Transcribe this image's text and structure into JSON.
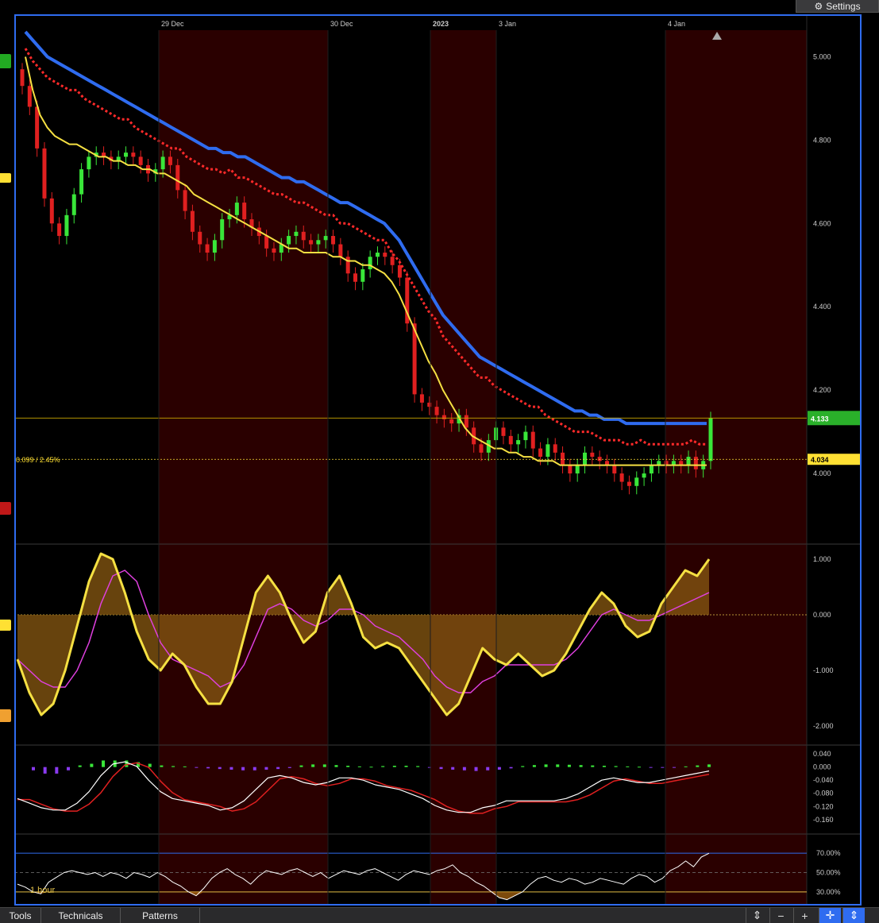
{
  "toolbar": {
    "settings_label": "Settings",
    "tabs": [
      "Tools",
      "Technicals",
      "Patterns"
    ],
    "buttons": [
      "⇕",
      "−",
      "+",
      "✛",
      "⇕"
    ]
  },
  "colors": {
    "up": "#39e639",
    "down": "#e02020",
    "ma_fast": "#f5e042",
    "ma_slow": "#2f6cf0",
    "stop": "#ff2a2a",
    "shade": "#2a0000",
    "price_tag": "#2ab02a",
    "ref_tag": "#ffe033"
  },
  "chart_data": [
    {
      "type": "candlestick",
      "x_labels": [
        "29 Dec",
        "30 Dec",
        "2023",
        "3 Jan",
        "4 Jan"
      ],
      "y_ticks": [
        "5.000",
        "4.800",
        "4.600",
        "4.400",
        "4.200",
        "4.000"
      ],
      "ylim": [
        3.84,
        5.06
      ],
      "last_price": "4.133",
      "last_price_value": 4.133,
      "reference_label": "0.099 / 2.45%",
      "reference_price": "4.034",
      "reference_value": 4.034,
      "close": [
        4.93,
        4.88,
        4.78,
        4.66,
        4.6,
        4.57,
        4.62,
        4.67,
        4.73,
        4.76,
        4.77,
        4.76,
        4.75,
        4.76,
        4.77,
        4.76,
        4.74,
        4.72,
        4.73,
        4.76,
        4.74,
        4.68,
        4.63,
        4.58,
        4.55,
        4.53,
        4.56,
        4.61,
        4.62,
        4.65,
        4.61,
        4.59,
        4.57,
        4.54,
        4.53,
        4.55,
        4.57,
        4.58,
        4.56,
        4.55,
        4.56,
        4.57,
        4.55,
        4.52,
        4.48,
        4.46,
        4.49,
        4.52,
        4.53,
        4.52,
        4.5,
        4.47,
        4.36,
        4.19,
        4.17,
        4.16,
        4.14,
        4.13,
        4.12,
        4.14,
        4.11,
        4.07,
        4.05,
        4.08,
        4.11,
        4.09,
        4.07,
        4.08,
        4.1,
        4.06,
        4.04,
        4.07,
        4.05,
        4.02,
        4.0,
        4.02,
        4.05,
        4.04,
        4.03,
        4.02,
        4.0,
        3.98,
        3.97,
        3.99,
        4.0,
        4.02,
        4.03,
        4.02,
        4.03,
        4.02,
        4.04,
        4.01,
        4.03,
        4.133
      ],
      "ma_fast": [
        5.0,
        4.92,
        4.86,
        4.83,
        4.81,
        4.8,
        4.79,
        4.79,
        4.78,
        4.77,
        4.76,
        4.76,
        4.75,
        4.75,
        4.74,
        4.74,
        4.73,
        4.73,
        4.72,
        4.72,
        4.71,
        4.7,
        4.69,
        4.67,
        4.66,
        4.65,
        4.64,
        4.63,
        4.62,
        4.61,
        4.6,
        4.59,
        4.58,
        4.57,
        4.56,
        4.55,
        4.54,
        4.54,
        4.53,
        4.53,
        4.53,
        4.53,
        4.52,
        4.52,
        4.51,
        4.51,
        4.5,
        4.5,
        4.49,
        4.48,
        4.46,
        4.43,
        4.39,
        4.35,
        4.31,
        4.27,
        4.24,
        4.2,
        4.17,
        4.14,
        4.11,
        4.09,
        4.08,
        4.07,
        4.06,
        4.06,
        4.05,
        4.05,
        4.04,
        4.04,
        4.03,
        4.03,
        4.03,
        4.02,
        4.02,
        4.02,
        4.02,
        4.02,
        4.02,
        4.02,
        4.02,
        4.02,
        4.02,
        4.02,
        4.02,
        4.02,
        4.02,
        4.02,
        4.02,
        4.02,
        4.02,
        4.02,
        4.02,
        4.02
      ],
      "ma_slow": [
        5.06,
        5.04,
        5.02,
        5.0,
        4.99,
        4.98,
        4.97,
        4.96,
        4.95,
        4.94,
        4.93,
        4.92,
        4.91,
        4.9,
        4.89,
        4.88,
        4.87,
        4.86,
        4.85,
        4.84,
        4.83,
        4.82,
        4.81,
        4.8,
        4.79,
        4.78,
        4.78,
        4.77,
        4.77,
        4.76,
        4.76,
        4.75,
        4.74,
        4.73,
        4.72,
        4.71,
        4.71,
        4.7,
        4.7,
        4.69,
        4.68,
        4.67,
        4.66,
        4.65,
        4.65,
        4.64,
        4.63,
        4.62,
        4.61,
        4.6,
        4.58,
        4.56,
        4.53,
        4.5,
        4.47,
        4.44,
        4.41,
        4.38,
        4.36,
        4.34,
        4.32,
        4.3,
        4.28,
        4.27,
        4.26,
        4.25,
        4.24,
        4.23,
        4.22,
        4.21,
        4.2,
        4.19,
        4.18,
        4.17,
        4.16,
        4.15,
        4.15,
        4.14,
        4.14,
        4.13,
        4.13,
        4.13,
        4.12,
        4.12,
        4.12,
        4.12,
        4.12,
        4.12,
        4.12,
        4.12,
        4.12,
        4.12,
        4.12,
        4.12
      ]
    },
    {
      "type": "line",
      "y_ticks": [
        "1.000",
        "0.000",
        "-1.000",
        "-2.000"
      ],
      "ylim": [
        -2.2,
        1.2
      ],
      "oscillator": [
        -0.8,
        -1.4,
        -1.8,
        -1.6,
        -1.0,
        -0.2,
        0.6,
        1.1,
        1.0,
        0.4,
        -0.3,
        -0.8,
        -1.0,
        -0.7,
        -0.9,
        -1.3,
        -1.6,
        -1.6,
        -1.2,
        -0.4,
        0.4,
        0.7,
        0.4,
        -0.1,
        -0.5,
        -0.3,
        0.4,
        0.7,
        0.2,
        -0.4,
        -0.6,
        -0.5,
        -0.6,
        -0.9,
        -1.2,
        -1.5,
        -1.8,
        -1.6,
        -1.1,
        -0.6,
        -0.8,
        -0.9,
        -0.7,
        -0.9,
        -1.1,
        -1.0,
        -0.7,
        -0.3,
        0.1,
        0.4,
        0.2,
        -0.2,
        -0.4,
        -0.3,
        0.2,
        0.5,
        0.8,
        0.7,
        1.0
      ],
      "signal": [
        -0.8,
        -1.0,
        -1.2,
        -1.3,
        -1.3,
        -1.0,
        -0.5,
        0.2,
        0.7,
        0.8,
        0.6,
        0.0,
        -0.5,
        -0.8,
        -0.9,
        -1.0,
        -1.1,
        -1.3,
        -1.2,
        -0.9,
        -0.4,
        0.1,
        0.2,
        0.1,
        -0.1,
        -0.2,
        -0.1,
        0.1,
        0.1,
        0.0,
        -0.2,
        -0.3,
        -0.4,
        -0.6,
        -0.8,
        -1.1,
        -1.3,
        -1.4,
        -1.4,
        -1.2,
        -1.1,
        -0.9,
        -0.9,
        -0.9,
        -0.9,
        -0.9,
        -0.8,
        -0.6,
        -0.3,
        0.0,
        0.1,
        0.0,
        -0.1,
        -0.1,
        0.0,
        0.1,
        0.2,
        0.3,
        0.4
      ]
    },
    {
      "type": "bar",
      "y_ticks": [
        "0.040",
        "0.000",
        "-0.040",
        "-0.080",
        "-0.120",
        "-0.160"
      ],
      "ylim": [
        -0.175,
        0.05
      ],
      "histogram": [
        -0.01,
        -0.02,
        -0.02,
        -0.01,
        0.005,
        0.01,
        0.02,
        0.02,
        0.02,
        0.015,
        0.01,
        0.005,
        0.003,
        0.002,
        -0.002,
        -0.004,
        -0.006,
        -0.008,
        -0.01,
        -0.01,
        -0.008,
        -0.006,
        -0.003,
        0.005,
        0.008,
        0.008,
        0.006,
        0.004,
        0.002,
        0.001,
        0.003,
        0.004,
        0.004,
        0.003,
        -0.002,
        -0.006,
        -0.008,
        -0.01,
        -0.012,
        -0.01,
        -0.008,
        -0.004,
        0.003,
        0.006,
        0.008,
        0.008,
        0.007,
        0.006,
        0.005,
        0.004,
        0.003,
        0.002,
        0.001,
        -0.001,
        -0.002,
        -0.001,
        0.002,
        0.005,
        0.008
      ]
    },
    {
      "type": "line",
      "y_ticks": [
        "70.00%",
        "50.00%",
        "30.00%"
      ],
      "ylim": [
        20,
        80
      ],
      "label": "1 hour",
      "values": [
        38,
        35,
        30,
        28,
        40,
        45,
        50,
        52,
        50,
        48,
        50,
        46,
        50,
        48,
        44,
        50,
        48,
        45,
        50,
        46,
        40,
        36,
        30,
        26,
        34,
        44,
        50,
        54,
        48,
        44,
        38,
        46,
        52,
        50,
        48,
        52,
        54,
        50,
        46,
        50,
        44,
        48,
        52,
        50,
        48,
        52,
        54,
        50,
        46,
        42,
        48,
        52,
        50,
        48,
        52,
        54,
        58,
        50,
        46,
        40,
        36,
        30,
        24,
        22,
        26,
        30,
        38,
        44,
        46,
        42,
        40,
        44,
        42,
        38,
        40,
        44,
        42,
        40,
        38,
        44,
        48,
        46,
        40,
        44,
        52,
        56,
        62,
        56,
        66,
        70
      ]
    }
  ]
}
